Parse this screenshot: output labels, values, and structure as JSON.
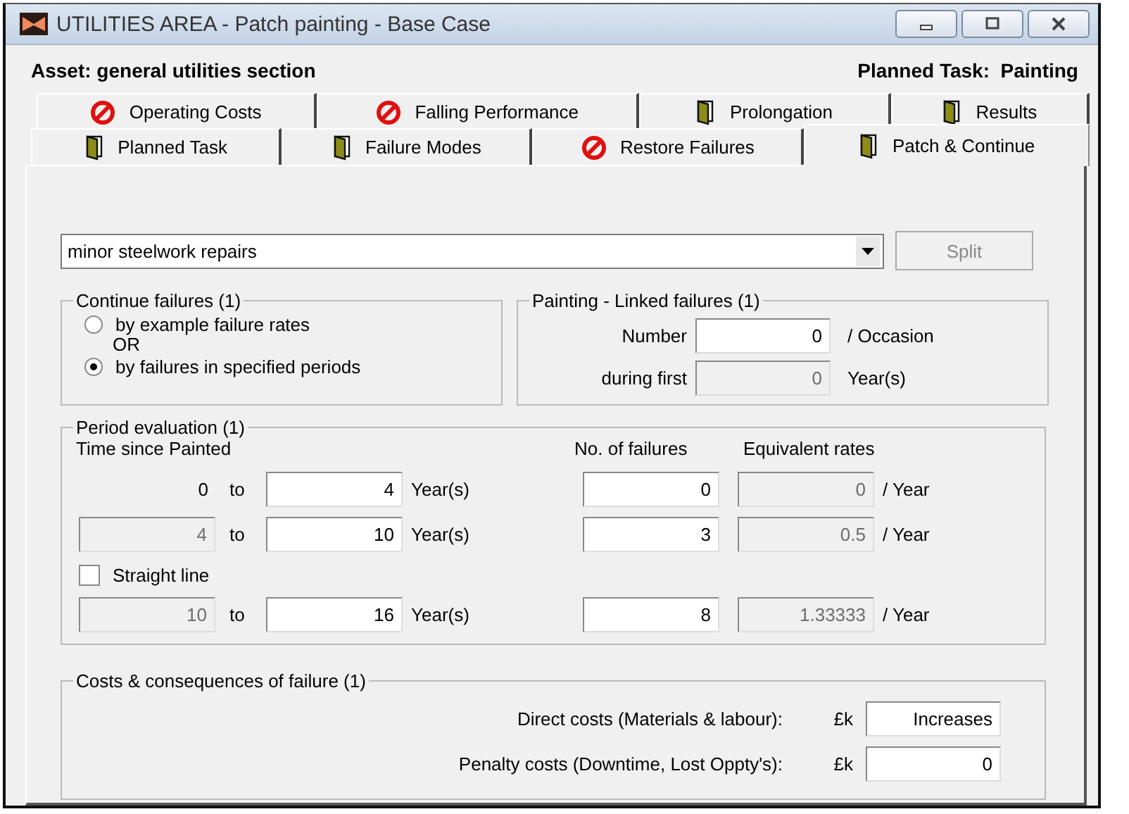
{
  "window": {
    "title": "UTILITIES AREA - Patch painting - Base Case"
  },
  "header": {
    "asset": "Asset: general utilities section",
    "planned_task": "Planned Task:  Painting"
  },
  "tab_rows": [
    [
      {
        "label": "Operating Costs",
        "kind": "blocked",
        "selected": false
      },
      {
        "label": "Falling Performance",
        "kind": "blocked",
        "selected": false
      },
      {
        "label": "Prolongation",
        "kind": "open",
        "selected": false
      },
      {
        "label": "Results",
        "kind": "open",
        "selected": false
      }
    ],
    [
      {
        "label": "Planned Task",
        "kind": "open",
        "selected": false
      },
      {
        "label": "Failure Modes",
        "kind": "open",
        "selected": false
      },
      {
        "label": "Restore Failures",
        "kind": "blocked",
        "selected": false
      },
      {
        "label": "Patch & Continue",
        "kind": "open",
        "selected": true
      }
    ]
  ],
  "failure_mode": {
    "value": "minor steelwork repairs"
  },
  "split_button": {
    "label": "Split",
    "disabled": true
  },
  "continue_failures": {
    "title": "Continue failures (1)",
    "separator": "OR",
    "options": [
      {
        "label": "by example failure rates",
        "selected": false
      },
      {
        "label": "by failures in specified periods",
        "selected": true
      }
    ]
  },
  "linked_failures": {
    "title": "Painting - Linked failures (1)",
    "rows": [
      {
        "label": "Number",
        "value": "0",
        "disabled": false,
        "unit": "/ Occasion"
      },
      {
        "label": "during first",
        "value": "0",
        "disabled": true,
        "unit": "Year(s)"
      }
    ]
  },
  "period_evaluation": {
    "title": "Period evaluation (1)",
    "time_header": "Time since Painted",
    "failures_header": "No. of failures",
    "rates_header": "Equivalent rates",
    "rows": [
      {
        "kind": "period",
        "from": "0",
        "from_is_field": false,
        "to_word": "to",
        "to": "4",
        "to_unit": "Year(s)",
        "failures": "0",
        "rate": "0",
        "rate_unit": "/ Year"
      },
      {
        "kind": "period",
        "from": "4",
        "from_is_field": true,
        "to_word": "to",
        "to": "10",
        "to_unit": "Year(s)",
        "failures": "3",
        "rate": "0.5",
        "rate_unit": "/ Year"
      },
      {
        "kind": "checkbox",
        "label": "Straight line",
        "checked": false
      },
      {
        "kind": "period",
        "from": "10",
        "from_is_field": true,
        "to_word": "to",
        "to": "16",
        "to_unit": "Year(s)",
        "failures": "8",
        "rate": "1.33333",
        "rate_unit": "/ Year"
      }
    ]
  },
  "costs": {
    "title": "Costs & consequences of failure (1)",
    "rows": [
      {
        "label": "Direct costs (Materials & labour):",
        "currency": "£k",
        "value": "Increases"
      },
      {
        "label": "Penalty costs (Downtime, Lost Oppty's):",
        "currency": "£k",
        "value": "0"
      }
    ]
  }
}
